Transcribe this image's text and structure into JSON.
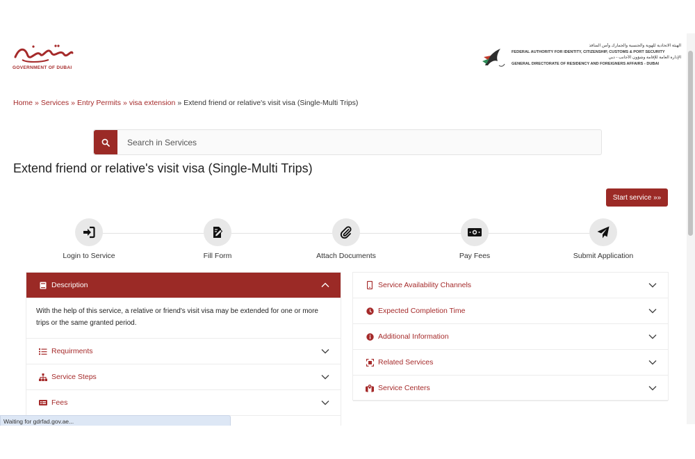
{
  "header": {
    "left_logo_caption": "GOVERNMENT OF DUBAI",
    "left_logo_arabic": "حكومة دبي",
    "right_logo_lines": [
      "الهيئة الاتحادية للهوية والجنسية والجمارك وأمن المنافذ",
      "FEDERAL AUTHORITY FOR IDENTITY, CITIZENSHIP, CUSTOMS & PORT SECURITY",
      "الإدارة العامة للإقامة وشؤون الأجانب - دبي",
      "GENERAL DIRECTORATE OF RESIDENCY AND FOREIGNERS AFFAIRS - DUBAI"
    ]
  },
  "breadcrumb": {
    "items": [
      "Home",
      "Services",
      "Entry Permits",
      "visa extension"
    ],
    "current": "Extend friend or relative's visit visa (Single-Multi Trips)",
    "separator": "»"
  },
  "search": {
    "placeholder": "Search in Services"
  },
  "page": {
    "title": "Extend friend or relative's visit visa (Single-Multi Trips)",
    "start_button": "Start service »»"
  },
  "steps": [
    {
      "label": "Login to Service",
      "icon": "login-icon"
    },
    {
      "label": "Fill Form",
      "icon": "form-icon"
    },
    {
      "label": "Attach Documents",
      "icon": "paperclip-icon"
    },
    {
      "label": "Pay Fees",
      "icon": "money-icon"
    },
    {
      "label": "Submit Application",
      "icon": "send-icon"
    }
  ],
  "left_accordion": {
    "description_title": "Description",
    "description_text": "With the help of this service, a relative or friend's visit visa may be extended for one or more trips or the same granted period.",
    "sections": [
      "Requirments",
      "Service Steps",
      "Fees"
    ]
  },
  "right_accordion": {
    "sections": [
      "Service Availability Channels",
      "Expected Completion Time",
      "Additional Information",
      "Related Services",
      "Service Centers"
    ]
  },
  "status": {
    "text": "Waiting for gdrfad.gov.ae..."
  },
  "colors": {
    "brand": "#9b2a26",
    "link": "#a52a2a"
  }
}
